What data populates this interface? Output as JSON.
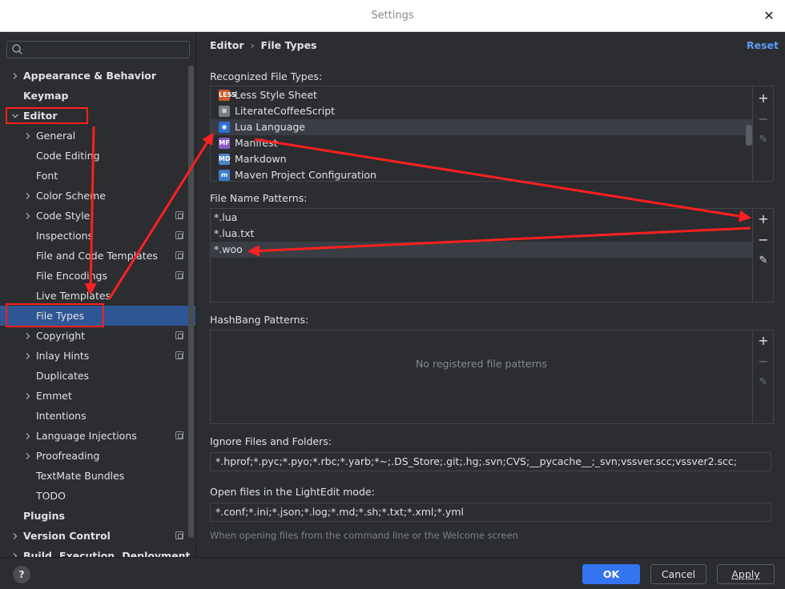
{
  "window": {
    "title": "Settings",
    "close_glyph": "✕"
  },
  "sidebar": {
    "items": [
      {
        "label": "Appearance & Behavior",
        "level": 0,
        "chevron": "right",
        "bold": true
      },
      {
        "label": "Keymap",
        "level": 0,
        "chevron": "none",
        "bold": true
      },
      {
        "label": "Editor",
        "level": 0,
        "chevron": "down",
        "bold": true
      },
      {
        "label": "General",
        "level": 1,
        "chevron": "right"
      },
      {
        "label": "Code Editing",
        "level": 1,
        "chevron": "none"
      },
      {
        "label": "Font",
        "level": 1,
        "chevron": "none"
      },
      {
        "label": "Color Scheme",
        "level": 1,
        "chevron": "right"
      },
      {
        "label": "Code Style",
        "level": 1,
        "chevron": "right",
        "project": true
      },
      {
        "label": "Inspections",
        "level": 1,
        "chevron": "none",
        "project": true
      },
      {
        "label": "File and Code Templates",
        "level": 1,
        "chevron": "none",
        "project": true
      },
      {
        "label": "File Encodings",
        "level": 1,
        "chevron": "none",
        "project": true
      },
      {
        "label": "Live Templates",
        "level": 1,
        "chevron": "none"
      },
      {
        "label": "File Types",
        "level": 1,
        "chevron": "none",
        "selected": true
      },
      {
        "label": "Copyright",
        "level": 1,
        "chevron": "right",
        "project": true
      },
      {
        "label": "Inlay Hints",
        "level": 1,
        "chevron": "right",
        "project": true
      },
      {
        "label": "Duplicates",
        "level": 1,
        "chevron": "none"
      },
      {
        "label": "Emmet",
        "level": 1,
        "chevron": "right"
      },
      {
        "label": "Intentions",
        "level": 1,
        "chevron": "none"
      },
      {
        "label": "Language Injections",
        "level": 1,
        "chevron": "right",
        "project": true
      },
      {
        "label": "Proofreading",
        "level": 1,
        "chevron": "right"
      },
      {
        "label": "TextMate Bundles",
        "level": 1,
        "chevron": "none"
      },
      {
        "label": "TODO",
        "level": 1,
        "chevron": "none"
      },
      {
        "label": "Plugins",
        "level": 0,
        "chevron": "none",
        "bold": true
      },
      {
        "label": "Version Control",
        "level": 0,
        "chevron": "right",
        "bold": true,
        "project": true
      },
      {
        "label": "Build, Execution, Deployment",
        "level": 0,
        "chevron": "right",
        "bold": true
      }
    ]
  },
  "breadcrumb": {
    "parent": "Editor",
    "separator": "›",
    "current": "File Types"
  },
  "reset_label": "Reset",
  "recognized": {
    "label": "Recognized File Types:",
    "items": [
      {
        "label": "Less Style Sheet",
        "icon": "less-icon",
        "icon_text": "LESS",
        "color": "#c75b2c"
      },
      {
        "label": "LiterateCoffeeScript",
        "icon": "coffee-icon",
        "icon_text": "≡",
        "color": "#7a7d84"
      },
      {
        "label": "Lua Language",
        "icon": "lua-icon",
        "icon_text": "◉",
        "color": "#2f6fd6",
        "selected": true
      },
      {
        "label": "Manifest",
        "icon": "manifest-icon",
        "icon_text": "MF",
        "color": "#8a5cc7"
      },
      {
        "label": "Markdown",
        "icon": "markdown-icon",
        "icon_text": "MD",
        "color": "#4d86c6"
      },
      {
        "label": "Maven Project Configuration",
        "icon": "maven-icon",
        "icon_text": "m",
        "color": "#3d7cc9"
      }
    ]
  },
  "patterns": {
    "label": "File Name Patterns:",
    "items": [
      {
        "value": "*.lua"
      },
      {
        "value": "*.lua.txt"
      },
      {
        "value": "*.woo",
        "selected": true
      }
    ]
  },
  "hashbang": {
    "label": "HashBang Patterns:",
    "empty": "No registered file patterns"
  },
  "ignore": {
    "label": "Ignore Files and Folders:",
    "value": "*.hprof;*.pyc;*.pyo;*.rbc;*.yarb;*~;.DS_Store;.git;.hg;.svn;CVS;__pycache__;_svn;vssver.scc;vssver2.scc;"
  },
  "lightedit": {
    "label": "Open files in the LightEdit mode:",
    "value": "*.conf;*.ini;*.json;*.log;*.md;*.sh;*.txt;*.xml;*.yml",
    "hint": "When opening files from the command line or the Welcome screen"
  },
  "toolbar": {
    "add": "+",
    "remove": "−",
    "edit": "✎"
  },
  "footer": {
    "help": "?",
    "ok": "OK",
    "cancel": "Cancel",
    "apply": "Apply"
  },
  "colors": {
    "accent": "#3574f0",
    "selection": "#2e5694",
    "annotation": "#ff2020",
    "link": "#5d9cf5"
  }
}
